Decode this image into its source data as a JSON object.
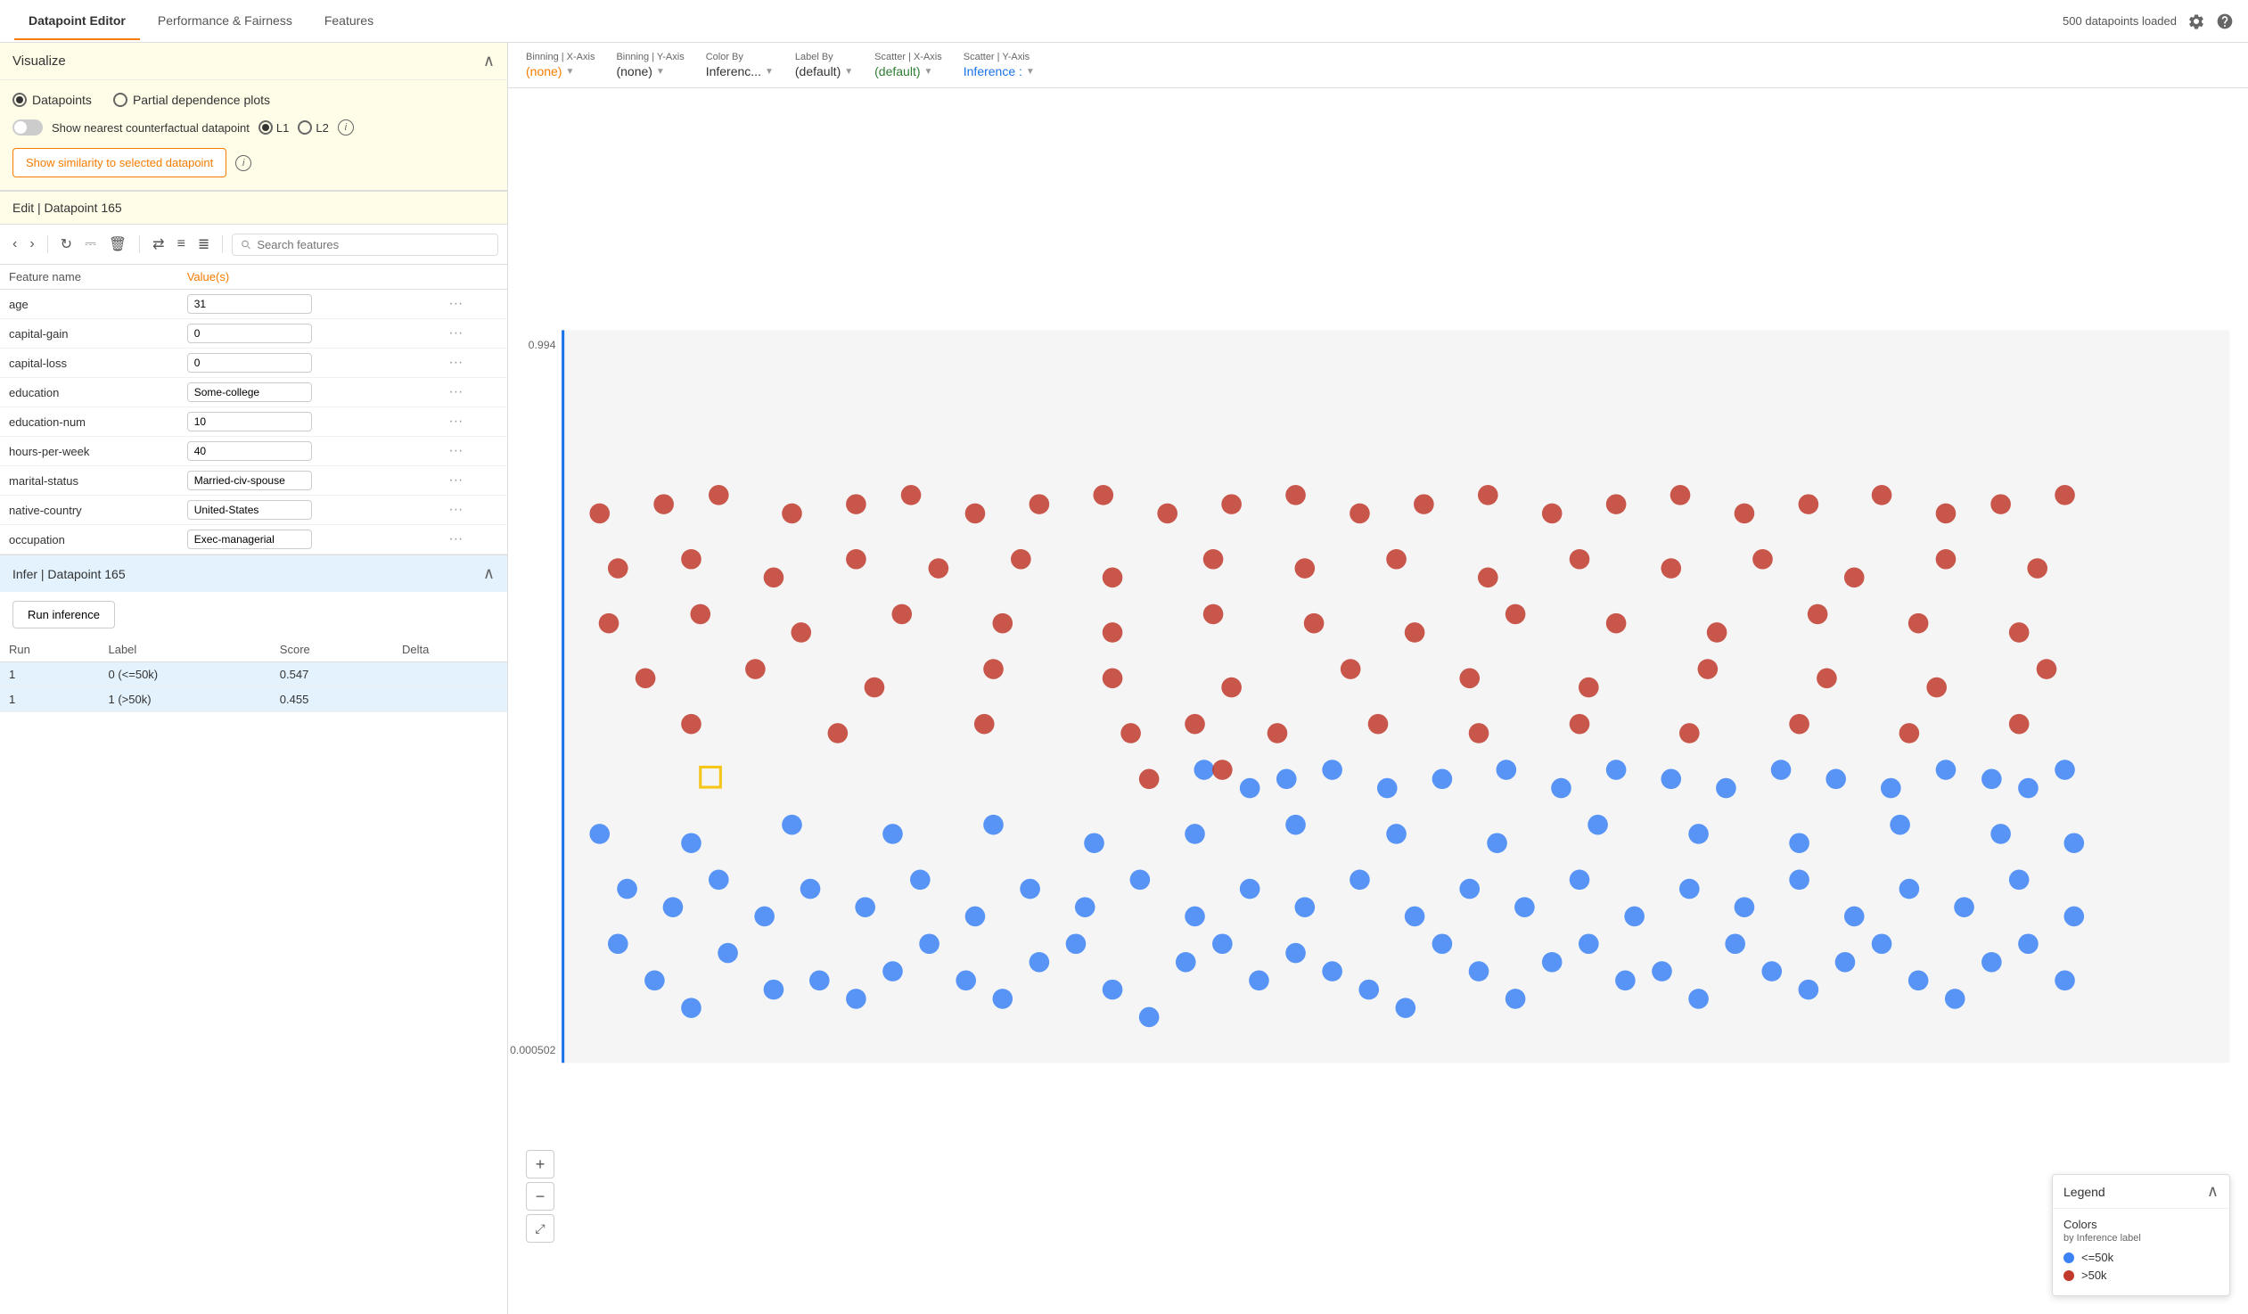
{
  "nav": {
    "tabs": [
      {
        "id": "datapoint-editor",
        "label": "Datapoint Editor",
        "active": true
      },
      {
        "id": "performance-fairness",
        "label": "Performance & Fairness",
        "active": false
      },
      {
        "id": "features",
        "label": "Features",
        "active": false
      }
    ],
    "status": "500 datapoints loaded"
  },
  "visualize": {
    "title": "Visualize",
    "radio_options": [
      "Datapoints",
      "Partial dependence plots"
    ],
    "selected_radio": "Datapoints",
    "toggle_label": "Show nearest counterfactual datapoint",
    "toggle_on": false,
    "l1_label": "L1",
    "l2_label": "L2",
    "similarity_btn_label": "Show similarity to selected datapoint"
  },
  "edit": {
    "title": "Edit | Datapoint 165",
    "search_placeholder": "Search features",
    "columns": [
      "Feature name",
      "Value(s)"
    ],
    "features": [
      {
        "name": "age",
        "value": "31"
      },
      {
        "name": "capital-gain",
        "value": "0"
      },
      {
        "name": "capital-loss",
        "value": "0"
      },
      {
        "name": "education",
        "value": "Some-college"
      },
      {
        "name": "education-num",
        "value": "10"
      },
      {
        "name": "hours-per-week",
        "value": "40"
      },
      {
        "name": "marital-status",
        "value": "Married-civ-spouse"
      },
      {
        "name": "native-country",
        "value": "United-States"
      },
      {
        "name": "occupation",
        "value": "Exec-managerial"
      }
    ]
  },
  "infer": {
    "title": "Infer | Datapoint 165",
    "run_btn_label": "Run inference",
    "columns": [
      "Run",
      "Label",
      "Score",
      "Delta"
    ],
    "rows": [
      {
        "run": "1",
        "label": "0 (<=50k)",
        "score": "0.547",
        "delta": "",
        "highlight": true
      },
      {
        "run": "1",
        "label": "1 (>50k)",
        "score": "0.455",
        "delta": "",
        "highlight": true
      }
    ]
  },
  "controls": {
    "binning_x": {
      "label": "Binning | X-Axis",
      "value": "(none)",
      "color": "orange"
    },
    "binning_y": {
      "label": "Binning | Y-Axis",
      "value": "(none)",
      "color": "black"
    },
    "color_by": {
      "label": "Color By",
      "value": "Inferenc...",
      "color": "black"
    },
    "label_by": {
      "label": "Label By",
      "value": "(default)",
      "color": "black"
    },
    "scatter_x": {
      "label": "Scatter | X-Axis",
      "value": "(default)",
      "color": "green"
    },
    "scatter_y": {
      "label": "Scatter | Y-Axis",
      "value": "Inference :",
      "color": "blue"
    }
  },
  "legend": {
    "title": "Legend",
    "colors_label": "Colors",
    "colors_subtitle": "by Inference label",
    "items": [
      {
        "color": "#3b82f6",
        "label": "<=50k"
      },
      {
        "color": "#c0392b",
        "label": ">50k"
      }
    ]
  },
  "chart": {
    "y_max": "0.994",
    "y_min": "0.000502",
    "blue_dots": [
      [
        120,
        680
      ],
      [
        160,
        720
      ],
      [
        200,
        750
      ],
      [
        240,
        690
      ],
      [
        290,
        730
      ],
      [
        340,
        720
      ],
      [
        380,
        740
      ],
      [
        420,
        710
      ],
      [
        460,
        680
      ],
      [
        500,
        720
      ],
      [
        540,
        740
      ],
      [
        580,
        700
      ],
      [
        620,
        680
      ],
      [
        660,
        730
      ],
      [
        700,
        760
      ],
      [
        740,
        700
      ],
      [
        780,
        680
      ],
      [
        820,
        720
      ],
      [
        860,
        690
      ],
      [
        900,
        710
      ],
      [
        940,
        730
      ],
      [
        980,
        750
      ],
      [
        1020,
        680
      ],
      [
        1060,
        710
      ],
      [
        1100,
        740
      ],
      [
        1140,
        700
      ],
      [
        1180,
        680
      ],
      [
        1220,
        720
      ],
      [
        1260,
        710
      ],
      [
        1300,
        740
      ],
      [
        1340,
        680
      ],
      [
        1380,
        710
      ],
      [
        1420,
        730
      ],
      [
        1460,
        700
      ],
      [
        1500,
        680
      ],
      [
        1540,
        720
      ],
      [
        1580,
        740
      ],
      [
        1620,
        700
      ],
      [
        1660,
        680
      ],
      [
        1700,
        720
      ],
      [
        130,
        620
      ],
      [
        180,
        640
      ],
      [
        230,
        610
      ],
      [
        280,
        650
      ],
      [
        330,
        620
      ],
      [
        390,
        640
      ],
      [
        450,
        610
      ],
      [
        510,
        650
      ],
      [
        570,
        620
      ],
      [
        630,
        640
      ],
      [
        690,
        610
      ],
      [
        750,
        650
      ],
      [
        810,
        620
      ],
      [
        870,
        640
      ],
      [
        930,
        610
      ],
      [
        990,
        650
      ],
      [
        1050,
        620
      ],
      [
        1110,
        640
      ],
      [
        1170,
        610
      ],
      [
        1230,
        650
      ],
      [
        1290,
        620
      ],
      [
        1350,
        640
      ],
      [
        1410,
        610
      ],
      [
        1470,
        650
      ],
      [
        1530,
        620
      ],
      [
        1590,
        640
      ],
      [
        1650,
        610
      ],
      [
        1710,
        650
      ],
      [
        100,
        560
      ],
      [
        200,
        570
      ],
      [
        310,
        550
      ],
      [
        420,
        560
      ],
      [
        530,
        550
      ],
      [
        640,
        570
      ],
      [
        750,
        560
      ],
      [
        860,
        550
      ],
      [
        970,
        560
      ],
      [
        1080,
        570
      ],
      [
        1190,
        550
      ],
      [
        1300,
        560
      ],
      [
        1410,
        570
      ],
      [
        1520,
        550
      ],
      [
        1630,
        560
      ],
      [
        1710,
        570
      ],
      [
        760,
        490
      ],
      [
        810,
        510
      ],
      [
        850,
        500
      ],
      [
        900,
        490
      ],
      [
        960,
        510
      ],
      [
        1020,
        500
      ],
      [
        1090,
        490
      ],
      [
        1150,
        510
      ],
      [
        1210,
        490
      ],
      [
        1270,
        500
      ],
      [
        1330,
        510
      ],
      [
        1390,
        490
      ],
      [
        1450,
        500
      ],
      [
        1510,
        510
      ],
      [
        1570,
        490
      ],
      [
        1620,
        500
      ],
      [
        1660,
        510
      ],
      [
        1700,
        490
      ]
    ],
    "red_dots": [
      [
        100,
        210
      ],
      [
        170,
        200
      ],
      [
        230,
        190
      ],
      [
        310,
        210
      ],
      [
        380,
        200
      ],
      [
        440,
        190
      ],
      [
        510,
        210
      ],
      [
        580,
        200
      ],
      [
        650,
        190
      ],
      [
        720,
        210
      ],
      [
        790,
        200
      ],
      [
        860,
        190
      ],
      [
        930,
        210
      ],
      [
        1000,
        200
      ],
      [
        1070,
        190
      ],
      [
        1140,
        210
      ],
      [
        1210,
        200
      ],
      [
        1280,
        190
      ],
      [
        1350,
        210
      ],
      [
        1420,
        200
      ],
      [
        1500,
        190
      ],
      [
        1570,
        210
      ],
      [
        1630,
        200
      ],
      [
        1700,
        190
      ],
      [
        120,
        270
      ],
      [
        200,
        260
      ],
      [
        290,
        280
      ],
      [
        380,
        260
      ],
      [
        470,
        270
      ],
      [
        560,
        260
      ],
      [
        660,
        280
      ],
      [
        770,
        260
      ],
      [
        870,
        270
      ],
      [
        970,
        260
      ],
      [
        1070,
        280
      ],
      [
        1170,
        260
      ],
      [
        1270,
        270
      ],
      [
        1370,
        260
      ],
      [
        1470,
        280
      ],
      [
        1570,
        260
      ],
      [
        1670,
        270
      ],
      [
        110,
        330
      ],
      [
        210,
        320
      ],
      [
        320,
        340
      ],
      [
        430,
        320
      ],
      [
        540,
        330
      ],
      [
        660,
        340
      ],
      [
        770,
        320
      ],
      [
        880,
        330
      ],
      [
        990,
        340
      ],
      [
        1100,
        320
      ],
      [
        1210,
        330
      ],
      [
        1320,
        340
      ],
      [
        1430,
        320
      ],
      [
        1540,
        330
      ],
      [
        1650,
        340
      ],
      [
        150,
        390
      ],
      [
        270,
        380
      ],
      [
        400,
        400
      ],
      [
        530,
        380
      ],
      [
        660,
        390
      ],
      [
        790,
        400
      ],
      [
        920,
        380
      ],
      [
        1050,
        390
      ],
      [
        1180,
        400
      ],
      [
        1310,
        380
      ],
      [
        1440,
        390
      ],
      [
        1560,
        400
      ],
      [
        1680,
        380
      ],
      [
        200,
        440
      ],
      [
        360,
        450
      ],
      [
        520,
        440
      ],
      [
        680,
        450
      ],
      [
        750,
        440
      ],
      [
        840,
        450
      ],
      [
        950,
        440
      ],
      [
        1060,
        450
      ],
      [
        1170,
        440
      ],
      [
        1290,
        450
      ],
      [
        1410,
        440
      ],
      [
        1530,
        450
      ],
      [
        1650,
        440
      ],
      [
        780,
        490
      ],
      [
        700,
        500
      ]
    ]
  }
}
